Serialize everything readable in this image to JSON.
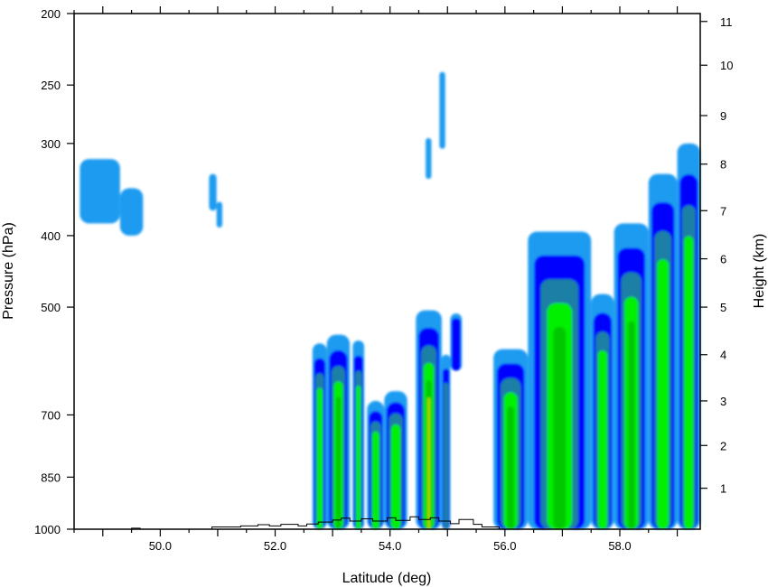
{
  "chart_data": {
    "type": "contour-cross-section",
    "xlabel": "Latitude (deg)",
    "ylabel": "Pressure (hPa)",
    "y2label": "Height (km)",
    "xlim": [
      48.5,
      59.4
    ],
    "ylim_pressure": [
      1000,
      200
    ],
    "y_scale": "log",
    "x_ticks": [
      "50.0",
      "52.0",
      "54.0",
      "56.0",
      "58.0"
    ],
    "x_tick_values": [
      50,
      52,
      54,
      56,
      58
    ],
    "y_ticks_pressure": [
      200,
      250,
      300,
      400,
      500,
      700,
      850,
      1000
    ],
    "y_ticks_height": [
      1,
      2,
      3,
      4,
      5,
      6,
      7,
      8,
      9,
      10,
      11
    ],
    "height_tick_pressure": [
      880,
      770,
      670,
      580,
      500,
      430,
      370,
      320,
      275,
      235,
      205
    ],
    "fill_levels": [
      {
        "color": "#1e9bf0"
      },
      {
        "color": "#0000ff"
      },
      {
        "color": "#1a7fa6"
      },
      {
        "color": "#00f000"
      },
      {
        "color": "#00c800"
      },
      {
        "color": "#ffd200"
      }
    ],
    "cells": [
      {
        "x0": 48.6,
        "x1": 49.3,
        "p_top": 315,
        "p_bot": 385,
        "max_level": 0
      },
      {
        "x0": 49.3,
        "x1": 49.7,
        "p_top": 345,
        "p_bot": 400,
        "max_level": 0
      },
      {
        "x0": 50.85,
        "x1": 50.98,
        "p_top": 330,
        "p_bot": 370,
        "max_level": 0
      },
      {
        "x0": 50.98,
        "x1": 51.08,
        "p_top": 360,
        "p_bot": 390,
        "max_level": 0
      },
      {
        "x0": 54.62,
        "x1": 54.72,
        "p_top": 295,
        "p_bot": 335,
        "max_level": 0
      },
      {
        "x0": 54.86,
        "x1": 54.96,
        "p_top": 240,
        "p_bot": 305,
        "max_level": 0
      },
      {
        "x0": 52.65,
        "x1": 52.9,
        "p_top": 560,
        "p_bot": 1000,
        "max_level": 3
      },
      {
        "x0": 52.9,
        "x1": 53.3,
        "p_top": 545,
        "p_bot": 1000,
        "max_level": 4
      },
      {
        "x0": 53.35,
        "x1": 53.55,
        "p_top": 555,
        "p_bot": 1000,
        "max_level": 3
      },
      {
        "x0": 53.6,
        "x1": 53.9,
        "p_top": 670,
        "p_bot": 1000,
        "max_level": 3
      },
      {
        "x0": 53.9,
        "x1": 54.3,
        "p_top": 650,
        "p_bot": 1000,
        "max_level": 3
      },
      {
        "x0": 54.45,
        "x1": 54.9,
        "p_top": 505,
        "p_bot": 1000,
        "max_level": 5
      },
      {
        "x0": 54.9,
        "x1": 55.05,
        "p_top": 580,
        "p_bot": 1000,
        "max_level": 2
      },
      {
        "x0": 55.05,
        "x1": 55.25,
        "p_top": 510,
        "p_bot": 610,
        "max_level": 1
      },
      {
        "x0": 55.8,
        "x1": 56.4,
        "p_top": 570,
        "p_bot": 1000,
        "max_level": 4
      },
      {
        "x0": 56.4,
        "x1": 57.5,
        "p_top": 395,
        "p_bot": 1000,
        "max_level": 4
      },
      {
        "x0": 57.5,
        "x1": 57.9,
        "p_top": 480,
        "p_bot": 1000,
        "max_level": 3
      },
      {
        "x0": 57.9,
        "x1": 58.5,
        "p_top": 385,
        "p_bot": 1000,
        "max_level": 4
      },
      {
        "x0": 58.5,
        "x1": 59.0,
        "p_top": 330,
        "p_bot": 1000,
        "max_level": 3
      },
      {
        "x0": 59.0,
        "x1": 59.4,
        "p_top": 300,
        "p_bot": 1000,
        "max_level": 3
      }
    ],
    "terrain": [
      [
        48.5,
        1000
      ],
      [
        49.5,
        1000
      ],
      [
        49.5,
        997
      ],
      [
        49.65,
        997
      ],
      [
        49.65,
        1000
      ],
      [
        50.9,
        1000
      ],
      [
        50.9,
        993
      ],
      [
        51.4,
        993
      ],
      [
        51.4,
        990
      ],
      [
        51.7,
        990
      ],
      [
        51.7,
        986
      ],
      [
        51.9,
        986
      ],
      [
        51.9,
        990
      ],
      [
        52.1,
        990
      ],
      [
        52.1,
        985
      ],
      [
        52.4,
        985
      ],
      [
        52.4,
        990
      ],
      [
        52.55,
        990
      ],
      [
        52.55,
        984
      ],
      [
        52.75,
        984
      ],
      [
        52.75,
        978
      ],
      [
        53.0,
        978
      ],
      [
        53.0,
        972
      ],
      [
        53.15,
        972
      ],
      [
        53.15,
        966
      ],
      [
        53.3,
        966
      ],
      [
        53.3,
        975
      ],
      [
        53.5,
        975
      ],
      [
        53.5,
        968
      ],
      [
        53.7,
        968
      ],
      [
        53.7,
        975
      ],
      [
        53.95,
        975
      ],
      [
        53.95,
        965
      ],
      [
        54.1,
        965
      ],
      [
        54.1,
        973
      ],
      [
        54.35,
        973
      ],
      [
        54.35,
        962
      ],
      [
        54.5,
        962
      ],
      [
        54.5,
        970
      ],
      [
        54.7,
        970
      ],
      [
        54.7,
        965
      ],
      [
        54.85,
        965
      ],
      [
        54.85,
        975
      ],
      [
        55.05,
        975
      ],
      [
        55.05,
        983
      ],
      [
        55.2,
        983
      ],
      [
        55.2,
        970
      ],
      [
        55.45,
        970
      ],
      [
        55.45,
        985
      ],
      [
        55.6,
        985
      ],
      [
        55.6,
        993
      ],
      [
        55.9,
        993
      ],
      [
        55.9,
        1000
      ],
      [
        59.4,
        1000
      ]
    ]
  }
}
